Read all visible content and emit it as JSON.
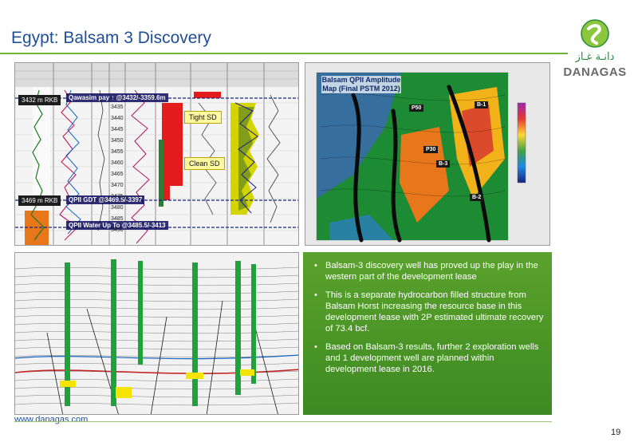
{
  "slide": {
    "title": "Egypt: Balsam 3 Discovery",
    "page_number": "19",
    "footer_url": "www.danagas.com"
  },
  "logo": {
    "arabic": "دانـة غـاز",
    "word": "DANAGAS"
  },
  "well_log": {
    "depth_top": "3432 m RKB",
    "depth_bottom": "3469 m RKB",
    "top_pick": "Qawasim pay ↑ @3432/-3359.6m",
    "gdt_pick": "QPII GDT @3469.5/-3397",
    "water_pick": "QPII Water Up To @3485.5/-3413",
    "callout_tight": "Tight SD",
    "callout_clean": "Clean SD",
    "depth_ticks": [
      "3435",
      "3440",
      "3445",
      "3450",
      "3455",
      "3460",
      "3465",
      "3470",
      "3475",
      "3480",
      "3485",
      "3490"
    ]
  },
  "amplitude_map": {
    "title": "Balsam QPII Amplitude Map (Final PSTM 2012)",
    "wells": [
      "B-1",
      "P50",
      "P30",
      "B-3",
      "B-2"
    ]
  },
  "bullets": [
    "Balsam-3 discovery well has proved up the play in the western part of the development lease",
    "This is a separate hydrocarbon filled structure from Balsam Horst increasing the resource base in this development lease with 2P estimated ultimate recovery of 73.4 bcf.",
    "Based on Balsam-3 results, further 2 exploration wells and 1 development well are planned within development lease in 2016."
  ],
  "colors": {
    "title": "#1f4e9a",
    "accent_green": "#5aa22c",
    "rule_green": "#6fb53a"
  }
}
